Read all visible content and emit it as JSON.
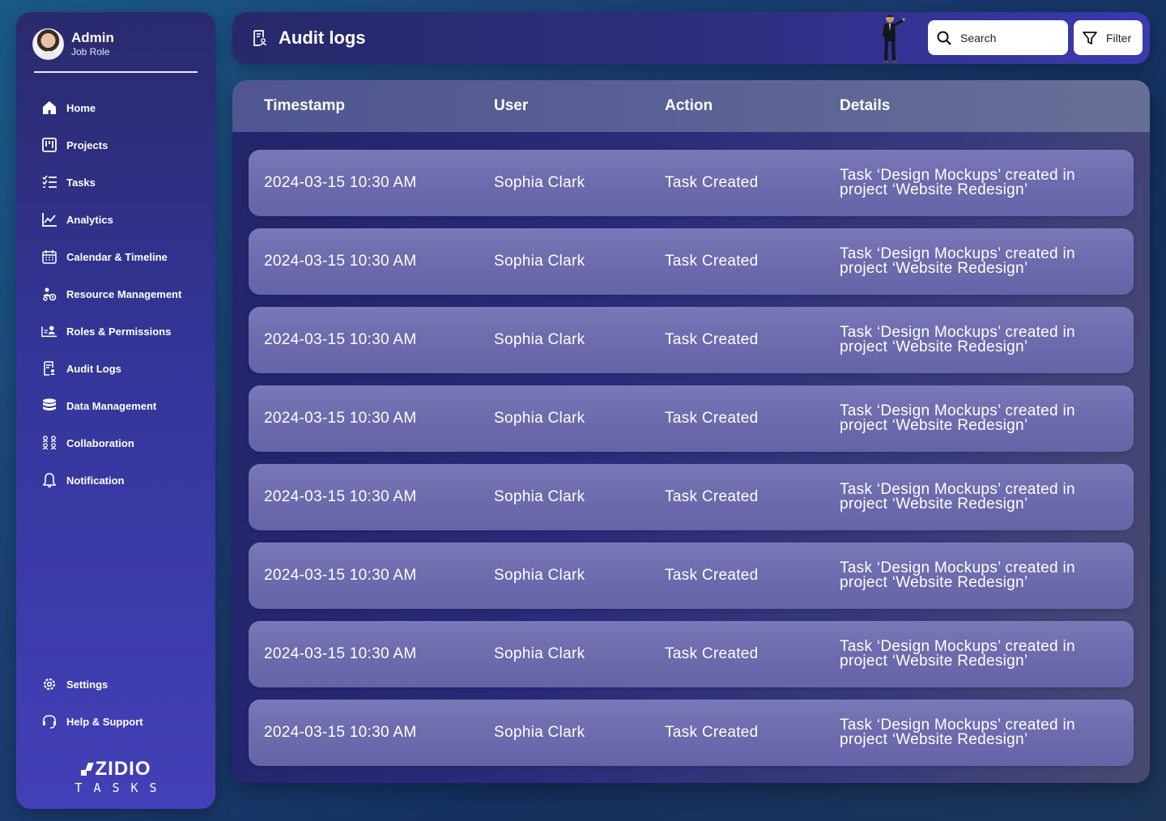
{
  "profile": {
    "name": "Admin",
    "role": "Job Role"
  },
  "sidebar": {
    "items": [
      {
        "label": "Home",
        "icon": "home-icon"
      },
      {
        "label": "Projects",
        "icon": "projects-icon"
      },
      {
        "label": "Tasks",
        "icon": "tasks-icon"
      },
      {
        "label": "Analytics",
        "icon": "analytics-icon"
      },
      {
        "label": "Calendar & Timeline",
        "icon": "calendar-icon"
      },
      {
        "label": "Resource Management",
        "icon": "resource-icon"
      },
      {
        "label": "Roles & Permissions",
        "icon": "roles-icon"
      },
      {
        "label": "Audit Logs",
        "icon": "audit-icon"
      },
      {
        "label": "Data Management",
        "icon": "database-icon"
      },
      {
        "label": "Collaboration",
        "icon": "collaboration-icon"
      },
      {
        "label": "Notification",
        "icon": "bell-icon"
      }
    ],
    "bottom": [
      {
        "label": "Settings",
        "icon": "gear-icon"
      },
      {
        "label": "Help & Support",
        "icon": "headset-icon"
      }
    ]
  },
  "logo": {
    "main": "ZIDIO",
    "sub": "TASKS"
  },
  "header": {
    "title": "Audit logs",
    "search_placeholder": "Search",
    "filter_label": "Filter"
  },
  "table": {
    "columns": [
      "Timestamp",
      "User",
      "Action",
      "Details"
    ],
    "rows": [
      {
        "timestamp": "2024-03-15 10:30 AM",
        "user": "Sophia Clark",
        "action": "Task Created",
        "details": "Task ‘Design Mockups’ created in project ‘Website Redesign’"
      },
      {
        "timestamp": "2024-03-15 10:30 AM",
        "user": "Sophia Clark",
        "action": "Task Created",
        "details": "Task ‘Design Mockups’ created in project ‘Website Redesign’"
      },
      {
        "timestamp": "2024-03-15 10:30 AM",
        "user": "Sophia Clark",
        "action": "Task Created",
        "details": "Task ‘Design Mockups’ created in project ‘Website Redesign’"
      },
      {
        "timestamp": "2024-03-15 10:30 AM",
        "user": "Sophia Clark",
        "action": "Task Created",
        "details": "Task ‘Design Mockups’ created in project ‘Website Redesign’"
      },
      {
        "timestamp": "2024-03-15 10:30 AM",
        "user": "Sophia Clark",
        "action": "Task Created",
        "details": "Task ‘Design Mockups’ created in project ‘Website Redesign’"
      },
      {
        "timestamp": "2024-03-15 10:30 AM",
        "user": "Sophia Clark",
        "action": "Task Created",
        "details": "Task ‘Design Mockups’ created in project ‘Website Redesign’"
      },
      {
        "timestamp": "2024-03-15 10:30 AM",
        "user": "Sophia Clark",
        "action": "Task Created",
        "details": "Task ‘Design Mockups’ created in project ‘Website Redesign’"
      },
      {
        "timestamp": "2024-03-15 10:30 AM",
        "user": "Sophia Clark",
        "action": "Task Created",
        "details": "Task ‘Design Mockups’ created in project ‘Website Redesign’"
      }
    ]
  }
}
